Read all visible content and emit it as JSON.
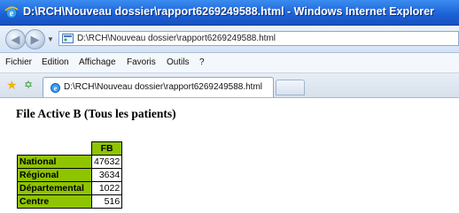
{
  "window": {
    "title": "D:\\RCH\\Nouveau dossier\\rapport6269249588.html - Windows Internet Explorer"
  },
  "address_bar": {
    "url": "D:\\RCH\\Nouveau dossier\\rapport6269249588.html"
  },
  "menu": {
    "items": [
      "Fichier",
      "Edition",
      "Affichage",
      "Favoris",
      "Outils",
      "?"
    ]
  },
  "tabs": {
    "active_label": "D:\\RCH\\Nouveau dossier\\rapport6269249588.html"
  },
  "page": {
    "heading": "File Active B (Tous les patients)",
    "table": {
      "column_header": "FB",
      "rows": [
        {
          "label": "National",
          "value": "47632"
        },
        {
          "label": "Régional",
          "value": "3634"
        },
        {
          "label": "Départemental",
          "value": "1022"
        },
        {
          "label": "Centre",
          "value": "516"
        }
      ]
    }
  },
  "colors": {
    "title_bar": "#1e63d8",
    "table_header_bg": "#8fc400"
  },
  "icons": {
    "browser": "ie-logo-icon",
    "favorites": "star-icon",
    "add_favorites": "add-favorite-icon",
    "page": "page-icon"
  }
}
